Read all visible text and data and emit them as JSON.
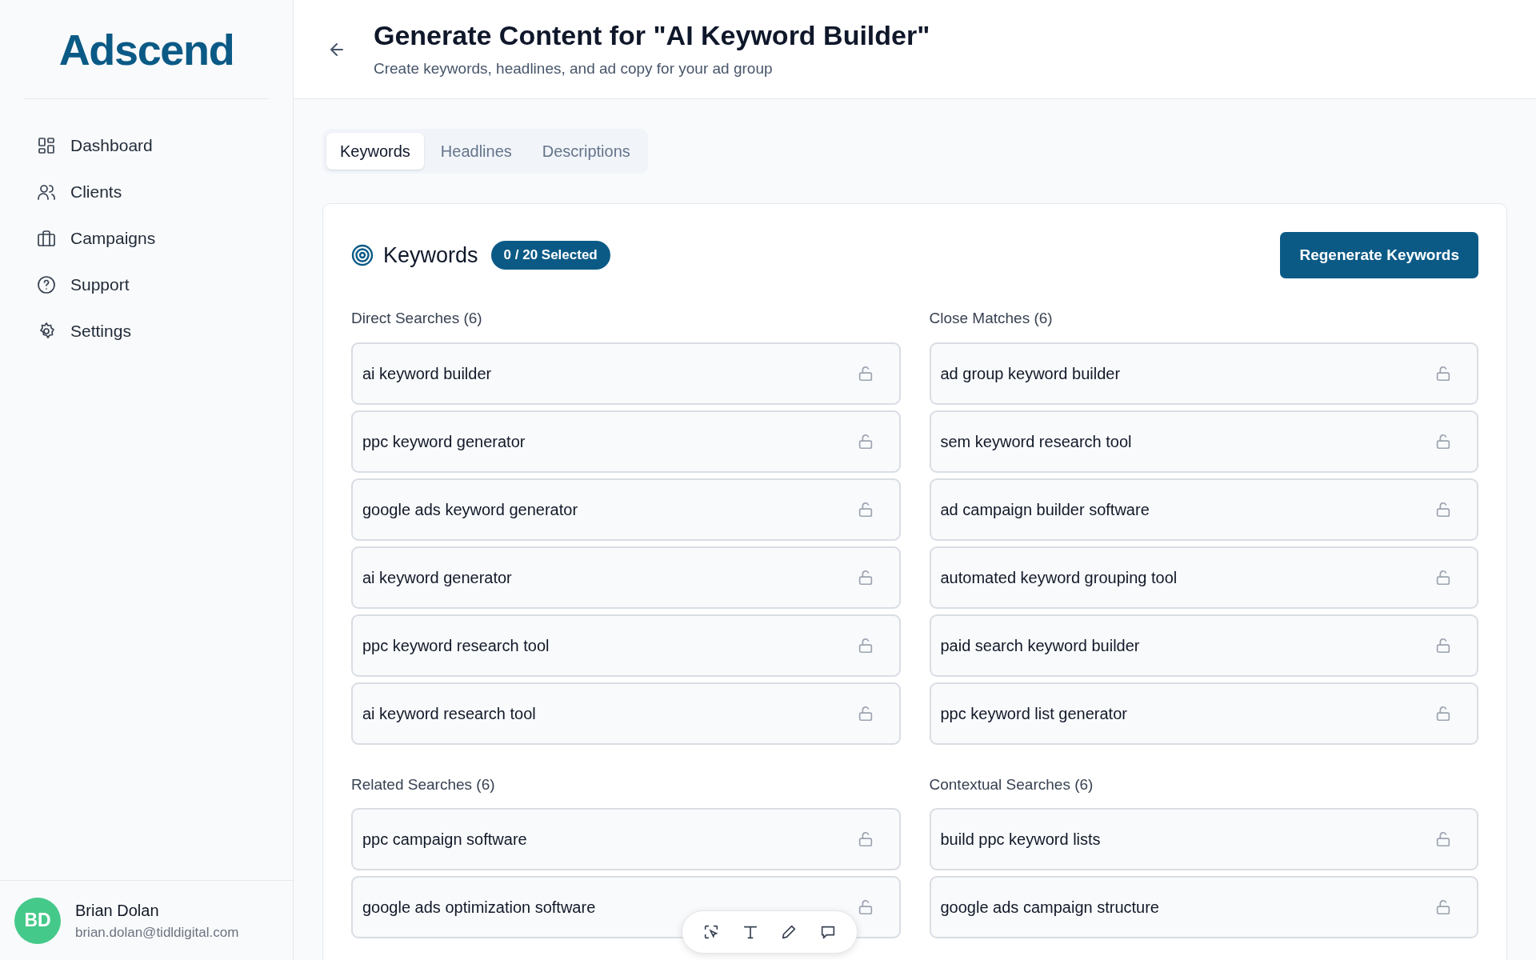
{
  "sidebar": {
    "logo": "Adscend",
    "nav": [
      {
        "label": "Dashboard"
      },
      {
        "label": "Clients"
      },
      {
        "label": "Campaigns"
      },
      {
        "label": "Support"
      },
      {
        "label": "Settings"
      }
    ],
    "user": {
      "initials": "BD",
      "name": "Brian Dolan",
      "email": "brian.dolan@tidldigital.com"
    }
  },
  "header": {
    "title": "Generate Content for \"AI Keyword Builder\"",
    "subtitle": "Create keywords, headlines, and ad copy for your ad group"
  },
  "tabs": [
    {
      "label": "Keywords",
      "selected": true
    },
    {
      "label": "Headlines",
      "selected": false
    },
    {
      "label": "Descriptions",
      "selected": false
    }
  ],
  "keywords": {
    "title": "Keywords",
    "badge": "0 / 20 Selected",
    "button": "Regenerate Keywords",
    "groups": [
      {
        "label": "Direct Searches (6)",
        "rows": [
          {
            "text": "ai keyword builder",
            "selected": false,
            "locked": false
          },
          {
            "text": "ppc keyword generator",
            "selected": false,
            "locked": false
          },
          {
            "text": "google ads keyword generator",
            "selected": false,
            "locked": false
          },
          {
            "text": "ai keyword generator",
            "selected": false,
            "locked": false
          },
          {
            "text": "ppc keyword research tool",
            "selected": false,
            "locked": false
          },
          {
            "text": "ai keyword research tool",
            "selected": false,
            "locked": false
          }
        ]
      },
      {
        "label": "Close Matches (6)",
        "rows": [
          {
            "text": "ad group keyword builder",
            "selected": false,
            "locked": false
          },
          {
            "text": "sem keyword research tool",
            "selected": false,
            "locked": false
          },
          {
            "text": "ad campaign builder software",
            "selected": false,
            "locked": false
          },
          {
            "text": "automated keyword grouping tool",
            "selected": false,
            "locked": false
          },
          {
            "text": "paid search keyword builder",
            "selected": false,
            "locked": false
          },
          {
            "text": "ppc keyword list generator",
            "selected": false,
            "locked": false
          }
        ]
      },
      {
        "label": "Related Searches (6)",
        "rows": [
          {
            "text": "ppc campaign software",
            "selected": false,
            "locked": false
          },
          {
            "text": "google ads optimization software",
            "selected": false,
            "locked": false
          }
        ]
      },
      {
        "label": "Contextual Searches (6)",
        "rows": [
          {
            "text": "build ppc keyword lists",
            "selected": false,
            "locked": false
          },
          {
            "text": "google ads campaign structure",
            "selected": false,
            "locked": false
          }
        ]
      }
    ]
  }
}
